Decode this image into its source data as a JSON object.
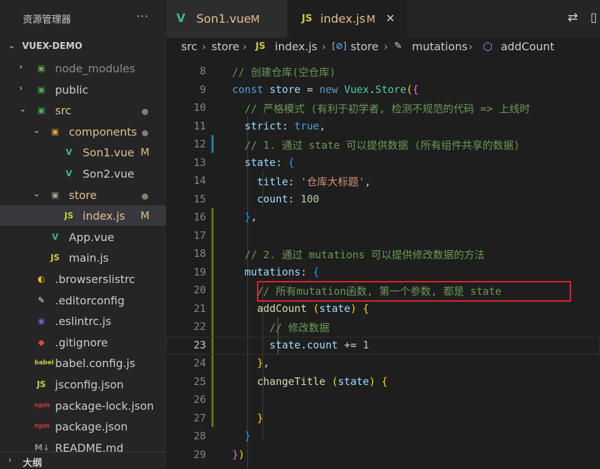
{
  "sidebar": {
    "title": "资源管理器",
    "more": "···",
    "project": "VUEX-DEMO",
    "items": [
      {
        "label": "node_modules",
        "chev": "›",
        "icon": "▣",
        "color": "#8a8a8a",
        "iconColor": "#6aa84f",
        "indent": 1,
        "status": ""
      },
      {
        "label": "public",
        "chev": "›",
        "icon": "▣",
        "color": "#cccccc",
        "iconColor": "#4caf50",
        "indent": 1,
        "status": ""
      },
      {
        "label": "src",
        "chev": "⌄",
        "icon": "▣",
        "color": "#e2c08d",
        "iconColor": "#4caf50",
        "indent": 1,
        "status": "dot"
      },
      {
        "label": "components",
        "chev": "⌄",
        "icon": "▣",
        "color": "#e2c08d",
        "iconColor": "#e8a33c",
        "indent": 2,
        "status": "dot"
      },
      {
        "label": "Son1.vue",
        "chev": "",
        "icon": "V",
        "color": "#e2c08d",
        "iconColor": "#41b883",
        "indent": 3,
        "status": "M"
      },
      {
        "label": "Son2.vue",
        "chev": "",
        "icon": "V",
        "color": "#cccccc",
        "iconColor": "#41b883",
        "indent": 3,
        "status": ""
      },
      {
        "label": "store",
        "chev": "⌄",
        "icon": "▣",
        "color": "#e2c08d",
        "iconColor": "#a89f8e",
        "indent": 2,
        "status": "dot"
      },
      {
        "label": "index.js",
        "chev": "",
        "icon": "JS",
        "color": "#e2c08d",
        "iconColor": "#cbcb41",
        "indent": 3,
        "status": "M"
      },
      {
        "label": "App.vue",
        "chev": "",
        "icon": "V",
        "color": "#cccccc",
        "iconColor": "#41b883",
        "indent": 2,
        "status": ""
      },
      {
        "label": "main.js",
        "chev": "",
        "icon": "JS",
        "color": "#cccccc",
        "iconColor": "#cbcb41",
        "indent": 2,
        "status": ""
      },
      {
        "label": ".browserslistrc",
        "chev": "",
        "icon": "◐",
        "color": "#cccccc",
        "iconColor": "#f5c300",
        "indent": 1,
        "status": ""
      },
      {
        "label": ".editorconfig",
        "chev": "",
        "icon": "✎",
        "color": "#cccccc",
        "iconColor": "#e0e0e0",
        "indent": 1,
        "status": ""
      },
      {
        "label": ".eslintrc.js",
        "chev": "",
        "icon": "◉",
        "color": "#cccccc",
        "iconColor": "#7a5cd6",
        "indent": 1,
        "status": ""
      },
      {
        "label": ".gitignore",
        "chev": "",
        "icon": "◆",
        "color": "#cccccc",
        "iconColor": "#e54d26",
        "indent": 1,
        "status": ""
      },
      {
        "label": "babel.config.js",
        "chev": "",
        "icon": "babel",
        "color": "#cccccc",
        "iconColor": "#cbcb41",
        "indent": 1,
        "status": ""
      },
      {
        "label": "jsconfig.json",
        "chev": "",
        "icon": "JS",
        "color": "#cccccc",
        "iconColor": "#cbcb41",
        "indent": 1,
        "status": ""
      },
      {
        "label": "package-lock.json",
        "chev": "",
        "icon": "npm",
        "color": "#cccccc",
        "iconColor": "#cb3837",
        "indent": 1,
        "status": ""
      },
      {
        "label": "package.json",
        "chev": "",
        "icon": "npm",
        "color": "#cccccc",
        "iconColor": "#cb3837",
        "indent": 1,
        "status": ""
      },
      {
        "label": "README.md",
        "chev": "",
        "icon": "M↓",
        "color": "#cccccc",
        "iconColor": "#8a8a8a",
        "indent": 1,
        "status": ""
      }
    ],
    "outline": "大纲"
  },
  "tabs": [
    {
      "icon": "V",
      "label": "Son1.vue",
      "status": "M"
    },
    {
      "icon": "JS",
      "label": "index.js",
      "status": "M",
      "close": "✕"
    }
  ],
  "breadcrumb": [
    "src",
    "store",
    "index.js",
    "store",
    "mutations",
    "addCount"
  ],
  "breadcrumb_icons": {
    "js": "JS",
    "var": "[⊘]",
    "wrench": "🔧",
    "cube": "⬡"
  },
  "editor": {
    "active_line": 23,
    "lines": [
      {
        "n": 8,
        "tokens": [
          [
            "cm",
            "// 创建仓库(空仓库)"
          ]
        ]
      },
      {
        "n": 9,
        "tokens": [
          [
            "kw",
            "const "
          ],
          [
            "var",
            "store"
          ],
          [
            "p",
            " = "
          ],
          [
            "kw",
            "new "
          ],
          [
            "cls",
            "Vuex"
          ],
          [
            "p",
            "."
          ],
          [
            "cls",
            "Store"
          ],
          [
            "br1",
            "("
          ],
          [
            "br2",
            "{"
          ]
        ]
      },
      {
        "n": 10,
        "tokens": [
          [
            "cm",
            "  // 严格模式 (有利于初学者, 检测不规范的代码 => 上线时"
          ]
        ]
      },
      {
        "n": 11,
        "tokens": [
          [
            "var",
            "  strict"
          ],
          [
            "p",
            ": "
          ],
          [
            "kw",
            "true"
          ],
          [
            "p",
            ","
          ]
        ]
      },
      {
        "n": 12,
        "tokens": [
          [
            "cm",
            "  // 1. 通过 state 可以提供数据 (所有组件共享的数据)"
          ]
        ]
      },
      {
        "n": 13,
        "tokens": [
          [
            "var",
            "  state"
          ],
          [
            "p",
            ": "
          ],
          [
            "br3",
            "{"
          ]
        ]
      },
      {
        "n": 14,
        "tokens": [
          [
            "var",
            "    title"
          ],
          [
            "p",
            ": "
          ],
          [
            "str",
            "'仓库大标题'"
          ],
          [
            "p",
            ","
          ]
        ]
      },
      {
        "n": 15,
        "tokens": [
          [
            "var",
            "    count"
          ],
          [
            "p",
            ": "
          ],
          [
            "num",
            "100"
          ]
        ]
      },
      {
        "n": 16,
        "tokens": [
          [
            "br3",
            "  }"
          ],
          [
            "p",
            ","
          ]
        ]
      },
      {
        "n": 17,
        "tokens": []
      },
      {
        "n": 18,
        "tokens": [
          [
            "cm",
            "  // 2. 通过 mutations 可以提供修改数据的方法"
          ]
        ]
      },
      {
        "n": 19,
        "tokens": [
          [
            "var",
            "  mutations"
          ],
          [
            "p",
            ": "
          ],
          [
            "br3",
            "{"
          ]
        ]
      },
      {
        "n": 20,
        "tokens": [
          [
            "cm",
            "    // 所有mutation函数, 第一个参数, 都是 state"
          ]
        ]
      },
      {
        "n": 21,
        "tokens": [
          [
            "fn",
            "    addCount "
          ],
          [
            "br1",
            "("
          ],
          [
            "var",
            "state"
          ],
          [
            "br1",
            ")"
          ],
          [
            "p",
            " "
          ],
          [
            "br1",
            "{"
          ]
        ]
      },
      {
        "n": 22,
        "tokens": [
          [
            "cm",
            "      // 修改数据"
          ]
        ]
      },
      {
        "n": 23,
        "tokens": [
          [
            "var",
            "      state"
          ],
          [
            "p",
            "."
          ],
          [
            "var",
            "count"
          ],
          [
            "p",
            " += "
          ],
          [
            "num",
            "1"
          ]
        ]
      },
      {
        "n": 24,
        "tokens": [
          [
            "br1",
            "    }"
          ],
          [
            "p",
            ","
          ]
        ]
      },
      {
        "n": 25,
        "tokens": [
          [
            "fn",
            "    changeTitle "
          ],
          [
            "br1",
            "("
          ],
          [
            "var",
            "state"
          ],
          [
            "br1",
            ")"
          ],
          [
            "p",
            " "
          ],
          [
            "br1",
            "{"
          ]
        ]
      },
      {
        "n": 26,
        "tokens": []
      },
      {
        "n": 27,
        "tokens": [
          [
            "br1",
            "    }"
          ]
        ]
      },
      {
        "n": 28,
        "tokens": [
          [
            "br3",
            "  }"
          ]
        ]
      },
      {
        "n": 29,
        "tokens": [
          [
            "br2",
            "}"
          ],
          [
            "br1",
            ")"
          ]
        ]
      }
    ]
  },
  "colors": {
    "accent": "#007acc",
    "highlight_box": "#e0242b",
    "modified": "#e2c08d",
    "gutter_added": "#587c0c",
    "gutter_modified": "#1b81a8"
  }
}
